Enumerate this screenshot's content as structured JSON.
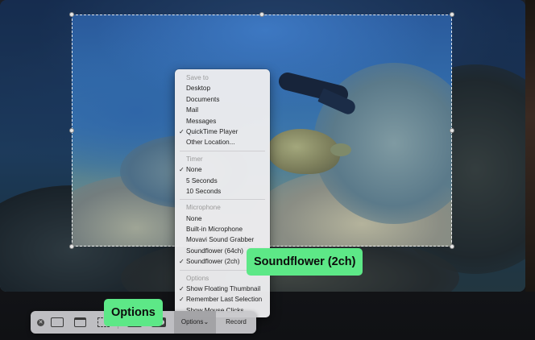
{
  "menu": {
    "save_to": {
      "header": "Save to",
      "items": [
        {
          "label": "Desktop",
          "checked": false
        },
        {
          "label": "Documents",
          "checked": false
        },
        {
          "label": "Mail",
          "checked": false
        },
        {
          "label": "Messages",
          "checked": false
        },
        {
          "label": "QuickTime Player",
          "checked": true
        },
        {
          "label": "Other Location...",
          "checked": false
        }
      ]
    },
    "timer": {
      "header": "Timer",
      "items": [
        {
          "label": "None",
          "checked": true
        },
        {
          "label": "5 Seconds",
          "checked": false
        },
        {
          "label": "10 Seconds",
          "checked": false
        }
      ]
    },
    "microphone": {
      "header": "Microphone",
      "items": [
        {
          "label": "None",
          "checked": false
        },
        {
          "label": "Built-in Microphone",
          "checked": false
        },
        {
          "label": "Movavi Sound Grabber",
          "checked": false
        },
        {
          "label": "Soundflower (64ch)",
          "checked": false
        },
        {
          "label": "Soundflower (2ch)",
          "checked": true
        }
      ]
    },
    "options": {
      "header": "Options",
      "items": [
        {
          "label": "Show Floating Thumbnail",
          "checked": true
        },
        {
          "label": "Remember Last Selection",
          "checked": true
        },
        {
          "label": "Show Mouse Clicks",
          "checked": false
        }
      ]
    },
    "check_glyph": "✓"
  },
  "toolbar": {
    "close_glyph": "✕",
    "options_label": "Options",
    "options_chevron": "⌄",
    "record_label": "Record"
  },
  "callouts": {
    "soundflower": "Soundflower (2ch)",
    "options": "Options"
  },
  "colors": {
    "callout": "#5de887"
  }
}
